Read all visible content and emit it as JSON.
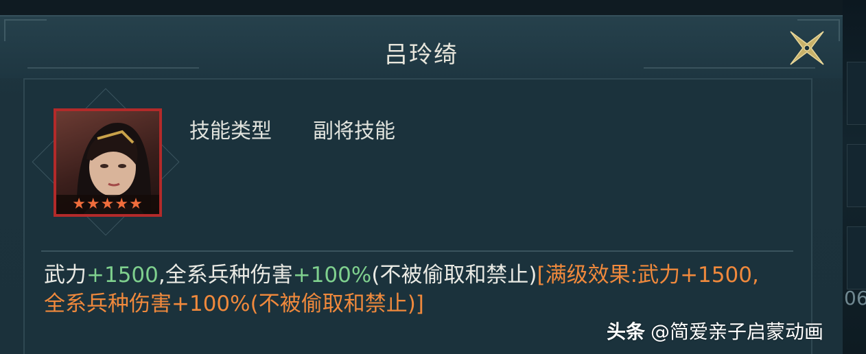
{
  "dialog": {
    "title": "吕玲绮",
    "close_icon": "close-x-icon"
  },
  "general": {
    "portrait_icon": "general-portrait",
    "stars": "★★★★★",
    "star_count": 5,
    "frame_color": "#b32a2a"
  },
  "skill": {
    "type_label": "技能类型",
    "type_value": "副将技能"
  },
  "description": {
    "p1": "武力",
    "v1": "+1500",
    "p2": ",全系兵种伤害",
    "v2": "+100%",
    "p3": "(不被偷取和禁止)",
    "max_line1": "[满级效果:武力+1500,",
    "max_line2": "全系兵种伤害+100%(不被偷取和禁止)]"
  },
  "side": {
    "number": "06"
  },
  "watermark": {
    "logo": "头条",
    "text": "@简爱亲子启蒙动画"
  },
  "colors": {
    "bonus_green": "#7fd08e",
    "max_orange": "#f0893c",
    "text": "#eaeae4"
  }
}
